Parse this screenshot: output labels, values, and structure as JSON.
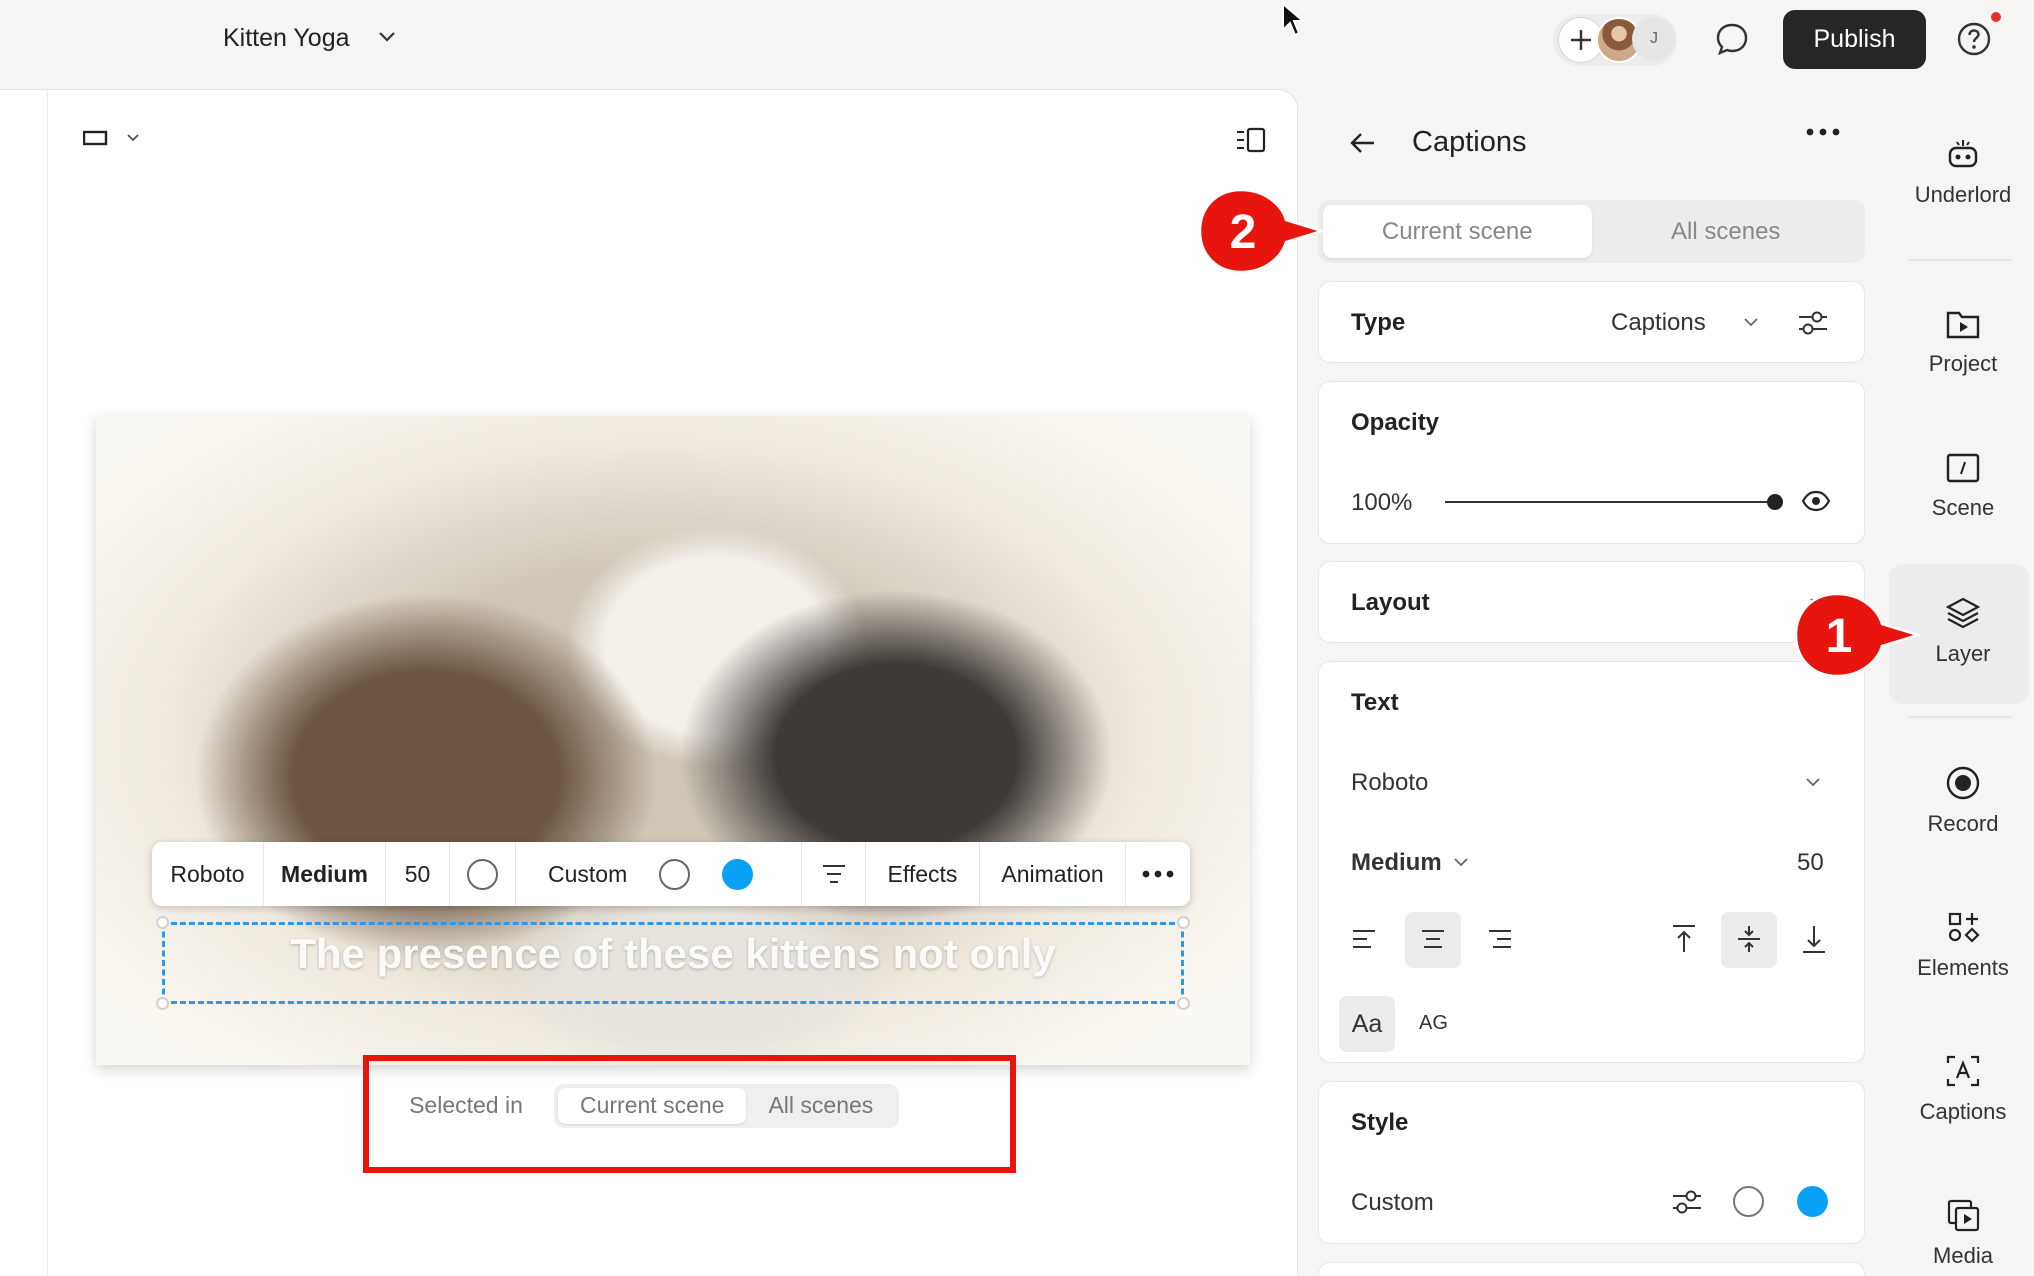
{
  "header": {
    "project_title": "Kitten Yoga",
    "collaborator_initial": "J",
    "publish_label": "Publish"
  },
  "canvas": {
    "caption_text": "The presence of these kittens not only",
    "toolbar": {
      "font": "Roboto",
      "weight": "Medium",
      "size": "50",
      "style": "Custom",
      "effects": "Effects",
      "animation": "Animation"
    },
    "selected_in": {
      "label": "Selected in",
      "current": "Current scene",
      "all": "All scenes"
    }
  },
  "panel": {
    "title": "Captions",
    "scope_tabs": {
      "current": "Current scene",
      "all": "All scenes"
    },
    "type": {
      "label": "Type",
      "value": "Captions"
    },
    "opacity": {
      "label": "Opacity",
      "value": "100%",
      "level": 1.0
    },
    "layout": {
      "label": "Layout"
    },
    "text": {
      "label": "Text",
      "font": "Roboto",
      "weight": "Medium",
      "size": "50",
      "case_sentence": "Aa",
      "case_upper": "AG"
    },
    "style": {
      "label": "Style",
      "value": "Custom"
    }
  },
  "rail": {
    "items": [
      {
        "label": "Underlord",
        "icon": "robot-icon"
      },
      {
        "label": "Project",
        "icon": "folder-play-icon"
      },
      {
        "label": "Scene",
        "icon": "scene-icon"
      },
      {
        "label": "Layer",
        "icon": "layers-icon"
      },
      {
        "label": "Record",
        "icon": "record-icon"
      },
      {
        "label": "Elements",
        "icon": "elements-icon"
      },
      {
        "label": "Captions",
        "icon": "captions-icon"
      },
      {
        "label": "Media",
        "icon": "media-icon"
      }
    ]
  },
  "callouts": {
    "one": "1",
    "two": "2"
  },
  "colors": {
    "accent_blue": "#0aa0f5",
    "selection_blue": "#2f97ea",
    "callout_red": "#e8150f",
    "publish_bg": "#262626"
  }
}
